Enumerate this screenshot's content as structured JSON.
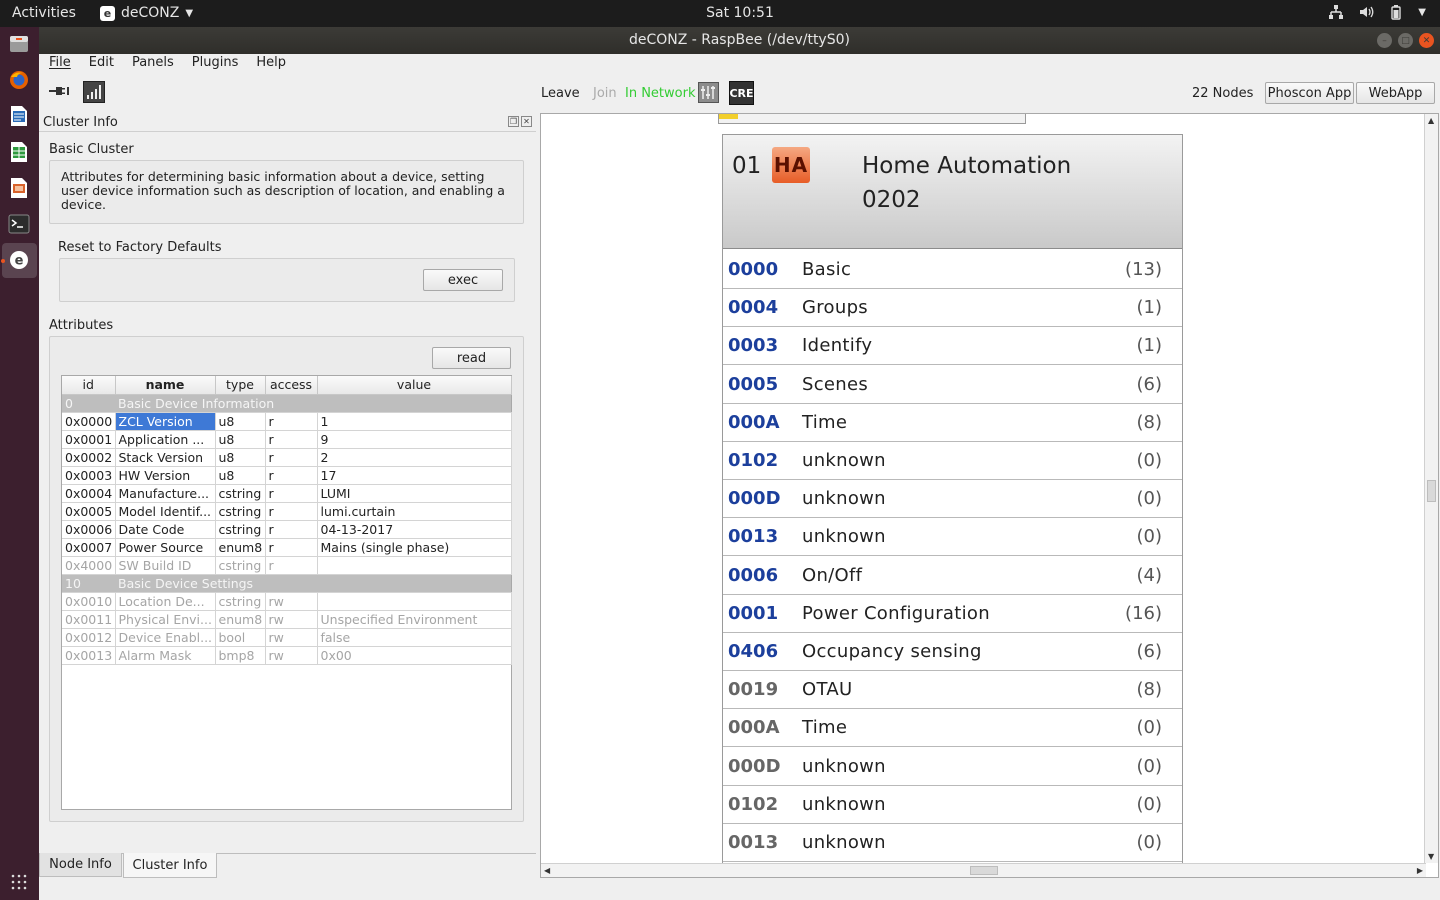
{
  "topbar": {
    "activities": "Activities",
    "app_name": "deCONZ",
    "app_icon": "e",
    "clock": "Sat 10:51"
  },
  "window": {
    "title": "deCONZ - RaspBee (/dev/ttyS0)"
  },
  "menu": [
    "File",
    "Edit",
    "Panels",
    "Plugins",
    "Help"
  ],
  "toolbar": {
    "leave": "Leave",
    "join": "Join",
    "in_network": "In Network",
    "cre": "CRE",
    "nodes": "22 Nodes",
    "phoscon": "Phoscon App",
    "webapp": "WebApp",
    "in_network_color": "#33cc33"
  },
  "panel": {
    "title": "Cluster Info",
    "cluster_name": "Basic Cluster",
    "cluster_desc": "Attributes for determining basic information about a device, setting user device information such as description of location, and enabling a device.",
    "reset_label": "Reset to Factory Defaults",
    "exec": "exec",
    "attributes_label": "Attributes",
    "read": "read",
    "columns": [
      "id",
      "name",
      "type",
      "access",
      "value"
    ],
    "rows": [
      {
        "kind": "group",
        "id": "0",
        "name": "Basic Device Information"
      },
      {
        "kind": "attr",
        "id": "0x0000",
        "name": "ZCL Version",
        "type": "u8",
        "access": "r",
        "value": "1",
        "selected": true
      },
      {
        "kind": "attr",
        "id": "0x0001",
        "name": "Application ...",
        "type": "u8",
        "access": "r",
        "value": "9"
      },
      {
        "kind": "attr",
        "id": "0x0002",
        "name": "Stack Version",
        "type": "u8",
        "access": "r",
        "value": "2"
      },
      {
        "kind": "attr",
        "id": "0x0003",
        "name": "HW Version",
        "type": "u8",
        "access": "r",
        "value": "17"
      },
      {
        "kind": "attr",
        "id": "0x0004",
        "name": "Manufacture...",
        "type": "cstring",
        "access": "r",
        "value": "LUMI"
      },
      {
        "kind": "attr",
        "id": "0x0005",
        "name": "Model Identif...",
        "type": "cstring",
        "access": "r",
        "value": "lumi.curtain"
      },
      {
        "kind": "attr",
        "id": "0x0006",
        "name": "Date Code",
        "type": "cstring",
        "access": "r",
        "value": "04-13-2017"
      },
      {
        "kind": "attr",
        "id": "0x0007",
        "name": "Power Source",
        "type": "enum8",
        "access": "r",
        "value": "Mains (single phase)"
      },
      {
        "kind": "dim",
        "id": "0x4000",
        "name": "SW Build ID",
        "type": "cstring",
        "access": "r",
        "value": ""
      },
      {
        "kind": "group",
        "id": "10",
        "name": "Basic Device Settings"
      },
      {
        "kind": "dim",
        "id": "0x0010",
        "name": "Location De...",
        "type": "cstring",
        "access": "rw",
        "value": ""
      },
      {
        "kind": "dim",
        "id": "0x0011",
        "name": "Physical Envi...",
        "type": "enum8",
        "access": "rw",
        "value": "Unspecified Environment"
      },
      {
        "kind": "dim",
        "id": "0x0012",
        "name": "Device Enabl...",
        "type": "bool",
        "access": "rw",
        "value": "false"
      },
      {
        "kind": "dim",
        "id": "0x0013",
        "name": "Alarm Mask",
        "type": "bmp8",
        "access": "rw",
        "value": "0x00"
      }
    ]
  },
  "tabs": [
    "Node Info",
    "Cluster Info"
  ],
  "node": {
    "endpoint": "01",
    "profile_icon": "HA",
    "profile_name": "Home Automation",
    "profile_id": "0202",
    "clusters": [
      {
        "id": "0000",
        "name": "Basic",
        "count": "(13)",
        "side": "server"
      },
      {
        "id": "0004",
        "name": "Groups",
        "count": "(1)",
        "side": "server"
      },
      {
        "id": "0003",
        "name": "Identify",
        "count": "(1)",
        "side": "server"
      },
      {
        "id": "0005",
        "name": "Scenes",
        "count": "(6)",
        "side": "server"
      },
      {
        "id": "000A",
        "name": "Time",
        "count": "(8)",
        "side": "server"
      },
      {
        "id": "0102",
        "name": "unknown",
        "count": "(0)",
        "side": "server"
      },
      {
        "id": "000D",
        "name": "unknown",
        "count": "(0)",
        "side": "server"
      },
      {
        "id": "0013",
        "name": "unknown",
        "count": "(0)",
        "side": "server"
      },
      {
        "id": "0006",
        "name": "On/Off",
        "count": "(4)",
        "side": "server"
      },
      {
        "id": "0001",
        "name": "Power Configuration",
        "count": "(16)",
        "side": "server"
      },
      {
        "id": "0406",
        "name": "Occupancy sensing",
        "count": "(6)",
        "side": "server"
      },
      {
        "id": "0019",
        "name": "OTAU",
        "count": "(8)",
        "side": "client"
      },
      {
        "id": "000A",
        "name": "Time",
        "count": "(0)",
        "side": "client"
      },
      {
        "id": "000D",
        "name": "unknown",
        "count": "(0)",
        "side": "client"
      },
      {
        "id": "0102",
        "name": "unknown",
        "count": "(0)",
        "side": "client"
      },
      {
        "id": "0013",
        "name": "unknown",
        "count": "(0)",
        "side": "client"
      }
    ]
  }
}
